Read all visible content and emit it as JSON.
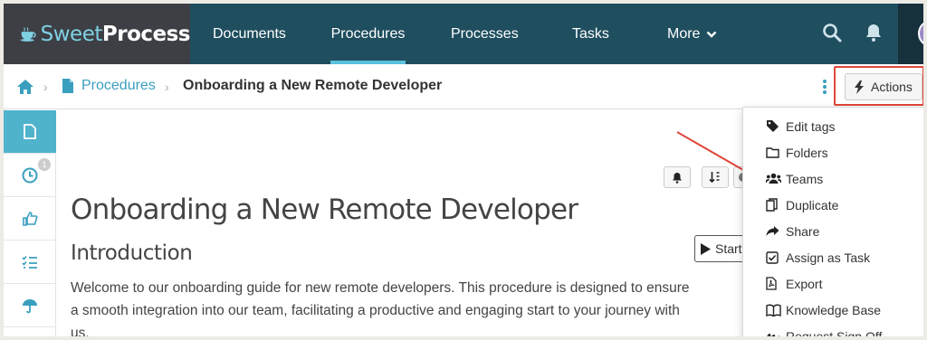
{
  "app": {
    "logo_light": "Sweet",
    "logo_bold": "Process"
  },
  "nav": {
    "items": [
      {
        "label": "Documents"
      },
      {
        "label": "Procedures"
      },
      {
        "label": "Processes"
      },
      {
        "label": "Tasks"
      },
      {
        "label": "More"
      }
    ],
    "active": "Procedures"
  },
  "breadcrumb": {
    "section": "Procedures",
    "current": "Onboarding a New Remote Developer"
  },
  "actions_button": {
    "label": "Actions"
  },
  "sidebar": {
    "history_badge": "1"
  },
  "document": {
    "title": "Onboarding a New Remote Developer",
    "section_heading": "Introduction",
    "paragraph": "Welcome to our onboarding guide for new remote developers. This procedure is designed to ensure a smooth integration into our team, facilitating a productive and engaging start to your journey with us.",
    "start_label": "Start"
  },
  "actions_menu": {
    "items": [
      {
        "label": "Edit tags",
        "icon": "tag-icon"
      },
      {
        "label": "Folders",
        "icon": "folder-icon"
      },
      {
        "label": "Teams",
        "icon": "users-icon"
      },
      {
        "label": "Duplicate",
        "icon": "copy-icon"
      },
      {
        "label": "Share",
        "icon": "share-icon"
      },
      {
        "label": "Assign as Task",
        "icon": "checkbox-icon"
      },
      {
        "label": "Export",
        "icon": "pdf-icon"
      },
      {
        "label": "Knowledge Base",
        "icon": "book-icon"
      },
      {
        "label": "Request Sign Off",
        "icon": "signature-icon"
      }
    ]
  },
  "colors": {
    "nav_bg": "#1f4e5f",
    "logo_bg": "#3d3f45",
    "accent": "#3a9fbf",
    "sidebar_active": "#4fb3cc",
    "highlight_red": "#e0473a"
  }
}
